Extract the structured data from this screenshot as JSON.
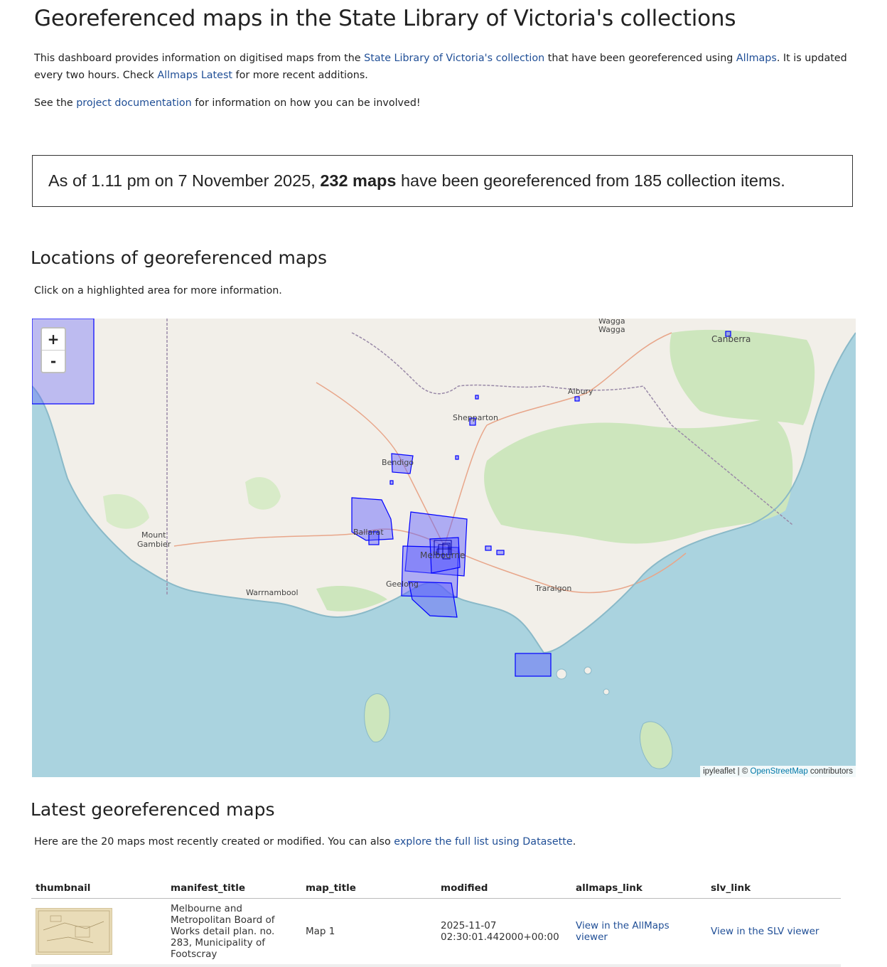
{
  "page": {
    "title": "Georeferenced maps in the State Library of Victoria's collections",
    "intro": {
      "t1": "This dashboard provides information on digitised maps from the ",
      "link1": "State Library of Victoria's collection",
      "t2": " that have been georeferenced using ",
      "link2": "Allmaps",
      "t3": ". It is updated every two hours. Check ",
      "link3": "Allmaps Latest",
      "t4": " for more recent additions."
    },
    "see": {
      "t1": "See the ",
      "link": "project documentation",
      "t2": " for information on how you can be involved!"
    }
  },
  "summary": {
    "prefix": "As of 1.11 pm on 7 November 2025, ",
    "bold": "232 maps",
    "suffix": " have been georeferenced from 185 collection items."
  },
  "locations": {
    "heading": "Locations of georeferenced maps",
    "hint": "Click on a highlighted area for more information."
  },
  "map": {
    "zoom_in": "+",
    "zoom_out": "-",
    "place_labels": {
      "wagga1": "Wagga",
      "wagga2": "Wagga",
      "canberra": "Canberra",
      "albury": "Albury",
      "shepparton": "Shepparton",
      "bendigo": "Bendigo",
      "ballarat": "Ballarat",
      "melbourne": "Melbourne",
      "mount": "Mount",
      "gambier": "Gambier",
      "warrnambool": "Warrnambool",
      "geelong": "Geelong",
      "traralgon": "Traralgon"
    },
    "attribution": {
      "prefix": "ipyleaflet | © ",
      "link": "OpenStreetMap",
      "suffix": " contributors"
    },
    "colors": {
      "water": "#aad3df",
      "land": "#f2efe9",
      "forest": "#cde6bd",
      "overlay_fill": "#5b5bff",
      "overlay_stroke": "#0000ff"
    }
  },
  "latest": {
    "heading": "Latest georeferenced maps",
    "text": {
      "t1": "Here are the 20 maps most recently created or modified. You can also ",
      "link": "explore the full list using Datasette",
      "t2": "."
    },
    "columns": [
      "thumbnail",
      "manifest_title",
      "map_title",
      "modified",
      "allmaps_link",
      "slv_link"
    ],
    "rows": [
      {
        "manifest_title": "Melbourne and Metropolitan Board of Works detail plan. no. 283, Municipality of Footscray",
        "map_title": "Map 1",
        "modified_date": "2025-11-07",
        "modified_time": "02:30:01.442000+00:00",
        "allmaps_link": "View in the AllMaps viewer",
        "slv_link": "View in the SLV viewer"
      }
    ]
  }
}
